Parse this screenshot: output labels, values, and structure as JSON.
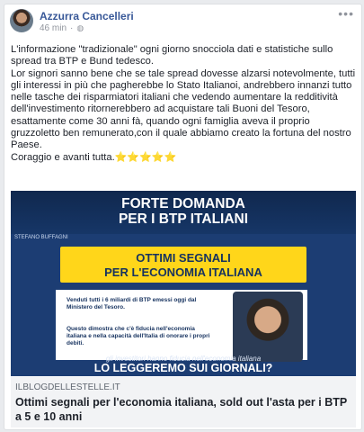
{
  "post": {
    "author": "Azzurra Cancelleri",
    "time": "46 min",
    "separator": "·",
    "more_icon": "more-icon",
    "privacy_icon": "globe-icon",
    "paragraph_1": "L'informazione \"tradizionale\" ogni giorno snocciola dati e statistiche sullo spread tra BTP e Bund tedesco.",
    "paragraph_2": "Lor signori sanno bene che se tale spread dovesse alzarsi notevolmente, tutti gli interessi in più che pagherebbe lo Stato Italianoi, andrebbero innanzi tutto nelle tasche dei risparmiatori italiani che vedendo aumentare la redditività dell'investimento ritornerebbero ad acquistare tali Buoni del Tesoro, esattamente come 30 anni fà, quando ogni famiglia aveva il proprio gruzzoletto ben remunerato,con il quale abbiamo creato la fortuna del nostro Paese.",
    "paragraph_3": "Coraggio e avanti tutta.",
    "stars": "⭐⭐⭐⭐⭐"
  },
  "link": {
    "image": {
      "headline_1": "FORTE DOMANDA",
      "headline_2": "PER I BTP ITALIANI",
      "tag": "STEFANO BUFFAGNI",
      "yellow_1": "OTTIMI SEGNALI",
      "yellow_2": "PER L'ECONOMIA ITALIANA",
      "box_1": "Venduti tutti i 6 miliardi di BTP emessi oggi dal Ministero del Tesoro.",
      "box_2": "Questo dimostra che c'è fiducia nell'economia italiana e nella capacità dell'Italia di onorare i propri debiti.",
      "subline": "gli investitori hanno fiducia nell'economia italiana",
      "bottom": "LO LEGGEREMO SUI GIORNALI?"
    },
    "domain": "ILBLOGDELLESTELLE.IT",
    "title": "Ottimi segnali per l'economia italiana, sold out l'asta per i BTP a 5 e 10 anni"
  },
  "colors": {
    "author_link": "#385898",
    "image_bg": "#1c3d73",
    "yellow": "#ffd61a",
    "flag_green": "#009246",
    "flag_white": "#ffffff",
    "flag_red": "#ce2b37"
  }
}
